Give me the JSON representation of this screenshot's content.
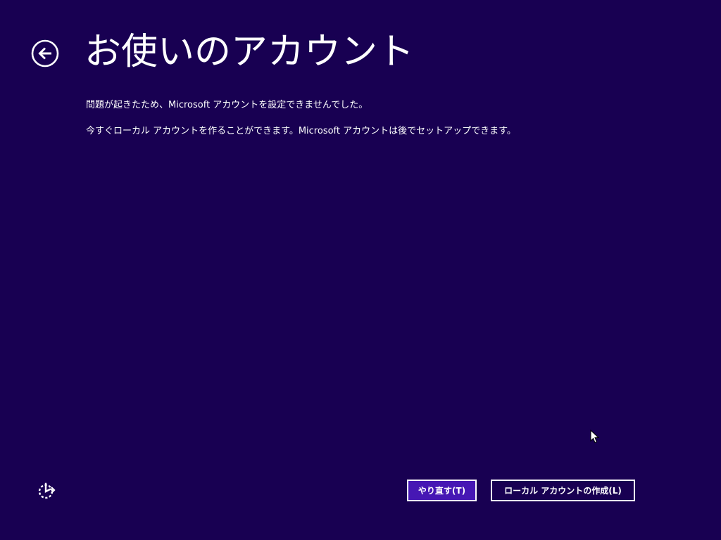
{
  "header": {
    "title": "お使いのアカウント",
    "back_icon": "back-arrow-circle-icon"
  },
  "messages": {
    "line1": "問題が起きたため、Microsoft アカウントを設定できませんでした。",
    "line2": "今すぐローカル アカウントを作ることができます。Microsoft アカウントは後でセットアップできます。"
  },
  "footer": {
    "ease_of_access_icon": "ease-of-access-icon",
    "retry_label": "やり直す(T)",
    "create_local_label": "ローカル アカウントの作成(L)"
  },
  "colors": {
    "background": "#180052",
    "primary_button": "#4617b4",
    "text": "#ffffff"
  }
}
